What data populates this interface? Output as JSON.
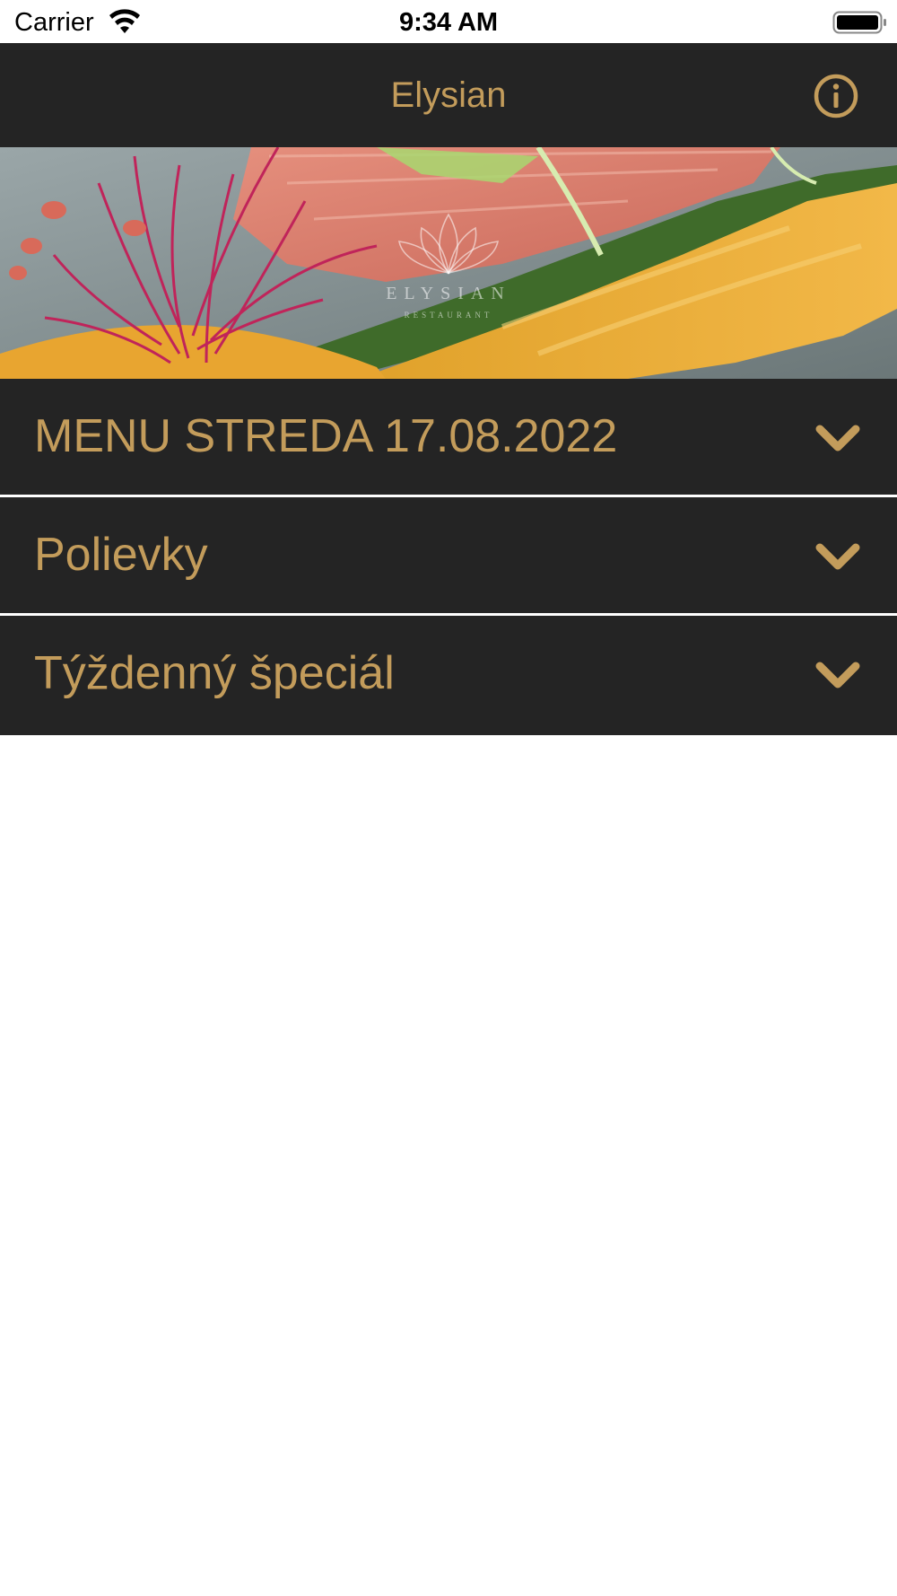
{
  "status_bar": {
    "carrier": "Carrier",
    "time": "9:34 AM",
    "wifi_icon": "wifi-icon",
    "battery_icon": "battery-full-icon"
  },
  "nav": {
    "title": "Elysian",
    "info_icon": "info-circle-icon"
  },
  "hero": {
    "watermark_name": "ELYSIAN",
    "watermark_sub": "RESTAURANT",
    "watermark_icon": "lotus-logo"
  },
  "menu": {
    "sections": [
      {
        "label": "MENU STREDA 17.08.2022",
        "icon": "chevron-down-icon"
      },
      {
        "label": "Polievky",
        "icon": "chevron-down-icon"
      },
      {
        "label": "Týždenný špeciál",
        "icon": "chevron-down-icon"
      }
    ]
  },
  "colors": {
    "accent": "#c39c5b",
    "bar_background": "#242424",
    "divider": "#ffffff",
    "background": "#ffffff"
  }
}
